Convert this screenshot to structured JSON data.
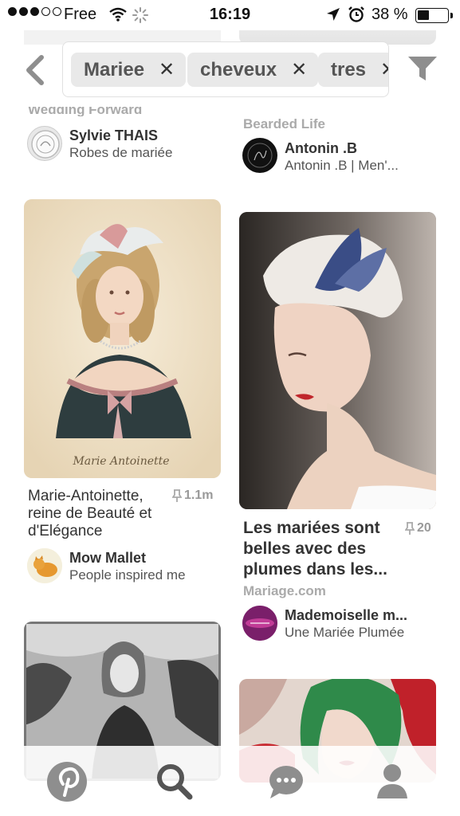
{
  "status_bar": {
    "carrier": "Free",
    "time": "16:19",
    "battery_percent": "38 %",
    "signal_bars_filled": 3,
    "signal_bars_total": 5,
    "battery_level": 0.38
  },
  "search": {
    "back_icon": "chevron-left-icon",
    "chips": [
      {
        "label": "Mariee"
      },
      {
        "label": "cheveux"
      },
      {
        "label": "tres"
      }
    ],
    "chip_remove_glyph": "✕",
    "filter_icon": "funnel-icon"
  },
  "feed": {
    "top_partial": {
      "left": {
        "source": "Wedding Forward",
        "user": "Sylvie THAIS",
        "board": "Robes de mariée"
      },
      "right": {
        "source": "Bearded Life",
        "user": "Antonin .B",
        "board": "Antonin .B | Men'..."
      }
    },
    "pins": [
      {
        "title": "Marie-Antoinette, reine de Beauté et d'Elégance",
        "title_lines": [
          "Marie-Antoinette,",
          "reine de Beauté et",
          "d'Elégance"
        ],
        "repins": "1.1m",
        "caption_on_image": "Marie Antoinette",
        "user": "Mow Mallet",
        "board": "People inspired me"
      },
      {
        "title": "Les mariées sont belles avec des plumes dans les...",
        "title_lines": [
          "Les mariées sont",
          "belles avec des",
          "plumes dans les..."
        ],
        "repins": "20",
        "source": "Mariage.com",
        "user": "Mademoiselle m...",
        "board": "Une Mariée Plumée"
      }
    ]
  },
  "tabbar": {
    "tabs": [
      {
        "icon": "pinterest-icon"
      },
      {
        "icon": "search-icon"
      },
      {
        "icon": "chat-icon"
      },
      {
        "icon": "profile-icon"
      }
    ]
  },
  "colors": {
    "chip_bg": "#e9e9e9",
    "tab_icon": "#8e8e8e",
    "tab_icon_active": "#555555",
    "mademoiselle_avatar": "#7a1f6a"
  }
}
